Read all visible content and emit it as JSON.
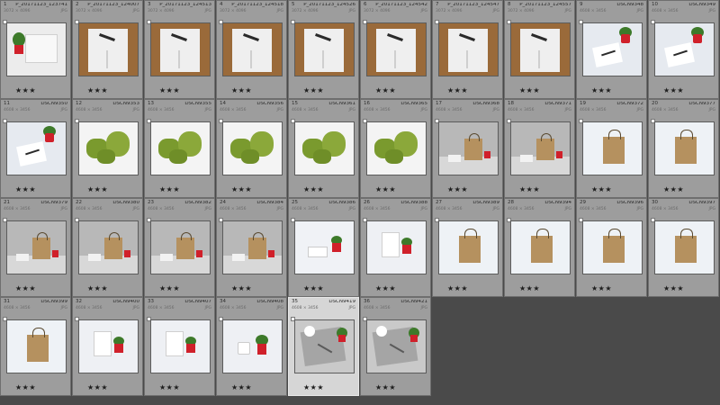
{
  "library": {
    "rating_glyph": "★",
    "thumbnails": [
      {
        "index": "1",
        "filename": "P_20171123_123741",
        "dims": "3072 × 4096",
        "ext": "JPG",
        "rating": 3,
        "scene": "notebook-plant",
        "selected": false
      },
      {
        "index": "2",
        "filename": "P_20171123_124007",
        "dims": "3072 × 4096",
        "ext": "JPG",
        "rating": 3,
        "scene": "notebook-board",
        "selected": false
      },
      {
        "index": "3",
        "filename": "P_20171123_124513",
        "dims": "3072 × 4096",
        "ext": "JPG",
        "rating": 3,
        "scene": "notebook-board",
        "selected": false
      },
      {
        "index": "4",
        "filename": "P_20171123_124518",
        "dims": "3072 × 4096",
        "ext": "JPG",
        "rating": 3,
        "scene": "notebook-board",
        "selected": false
      },
      {
        "index": "5",
        "filename": "P_20171123_124526",
        "dims": "3072 × 4096",
        "ext": "JPG",
        "rating": 3,
        "scene": "notebook-board",
        "selected": false
      },
      {
        "index": "6",
        "filename": "P_20171123_124542",
        "dims": "3072 × 4096",
        "ext": "JPG",
        "rating": 3,
        "scene": "notebook-board",
        "selected": false
      },
      {
        "index": "7",
        "filename": "P_20171123_124547",
        "dims": "3072 × 4096",
        "ext": "JPG",
        "rating": 3,
        "scene": "notebook-board",
        "selected": false
      },
      {
        "index": "8",
        "filename": "P_20171123_124557",
        "dims": "3072 × 4096",
        "ext": "JPG",
        "rating": 3,
        "scene": "notebook-board",
        "selected": false
      },
      {
        "index": "9",
        "filename": "DSCN9348",
        "dims": "4608 × 3456",
        "ext": "JPG",
        "rating": 3,
        "scene": "plant-flatlay",
        "selected": false
      },
      {
        "index": "10",
        "filename": "DSCN9349",
        "dims": "4608 × 3456",
        "ext": "JPG",
        "rating": 3,
        "scene": "plant-flatlay",
        "selected": false
      },
      {
        "index": "11",
        "filename": "DSCN9350",
        "dims": "4608 × 3456",
        "ext": "JPG",
        "rating": 3,
        "scene": "plant-flatlay",
        "selected": false
      },
      {
        "index": "12",
        "filename": "DSCN9353",
        "dims": "4608 × 3456",
        "ext": "JPG",
        "rating": 3,
        "scene": "moss",
        "selected": false
      },
      {
        "index": "13",
        "filename": "DSCN9355",
        "dims": "4608 × 3456",
        "ext": "JPG",
        "rating": 3,
        "scene": "moss",
        "selected": false
      },
      {
        "index": "14",
        "filename": "DSCN9356",
        "dims": "4608 × 3456",
        "ext": "JPG",
        "rating": 3,
        "scene": "moss",
        "selected": false
      },
      {
        "index": "15",
        "filename": "DSCN9361",
        "dims": "4608 × 3456",
        "ext": "JPG",
        "rating": 3,
        "scene": "moss",
        "selected": false
      },
      {
        "index": "16",
        "filename": "DSCN9365",
        "dims": "4608 × 3456",
        "ext": "JPG",
        "rating": 3,
        "scene": "moss",
        "selected": false
      },
      {
        "index": "17",
        "filename": "DSCN9368",
        "dims": "4608 × 3456",
        "ext": "JPG",
        "rating": 3,
        "scene": "bag-studio",
        "selected": false
      },
      {
        "index": "18",
        "filename": "DSCN9371",
        "dims": "4608 × 3456",
        "ext": "JPG",
        "rating": 3,
        "scene": "bag-studio",
        "selected": false
      },
      {
        "index": "19",
        "filename": "DSCN9372",
        "dims": "4608 × 3456",
        "ext": "JPG",
        "rating": 3,
        "scene": "bag-white",
        "selected": false
      },
      {
        "index": "20",
        "filename": "DSCN9377",
        "dims": "4608 × 3456",
        "ext": "JPG",
        "rating": 3,
        "scene": "bag-white",
        "selected": false
      },
      {
        "index": "21",
        "filename": "DSCN9379",
        "dims": "4608 × 3456",
        "ext": "JPG",
        "rating": 3,
        "scene": "bag-studio",
        "selected": false
      },
      {
        "index": "22",
        "filename": "DSCN9380",
        "dims": "4608 × 3456",
        "ext": "JPG",
        "rating": 3,
        "scene": "bag-studio",
        "selected": false
      },
      {
        "index": "23",
        "filename": "DSCN9382",
        "dims": "4608 × 3456",
        "ext": "JPG",
        "rating": 3,
        "scene": "bag-studio",
        "selected": false
      },
      {
        "index": "24",
        "filename": "DSCN9384",
        "dims": "4608 × 3456",
        "ext": "JPG",
        "rating": 3,
        "scene": "bag-studio",
        "selected": false
      },
      {
        "index": "25",
        "filename": "DSCN9386",
        "dims": "4608 × 3456",
        "ext": "JPG",
        "rating": 3,
        "scene": "box-plant",
        "selected": false
      },
      {
        "index": "26",
        "filename": "DSCN9388",
        "dims": "4608 × 3456",
        "ext": "JPG",
        "rating": 3,
        "scene": "card-plant",
        "selected": false
      },
      {
        "index": "27",
        "filename": "DSCN9389",
        "dims": "4608 × 3456",
        "ext": "JPG",
        "rating": 3,
        "scene": "bag-white",
        "selected": false
      },
      {
        "index": "28",
        "filename": "DSCN9394",
        "dims": "4608 × 3456",
        "ext": "JPG",
        "rating": 3,
        "scene": "bag-white",
        "selected": false
      },
      {
        "index": "29",
        "filename": "DSCN9396",
        "dims": "4608 × 3456",
        "ext": "JPG",
        "rating": 3,
        "scene": "bag-white",
        "selected": false
      },
      {
        "index": "30",
        "filename": "DSCN9397",
        "dims": "4608 × 3456",
        "ext": "JPG",
        "rating": 3,
        "scene": "bag-white",
        "selected": false
      },
      {
        "index": "31",
        "filename": "DSCN9399",
        "dims": "4608 × 3456",
        "ext": "JPG",
        "rating": 3,
        "scene": "bag-white",
        "selected": false
      },
      {
        "index": "32",
        "filename": "DSCN9400",
        "dims": "4608 × 3456",
        "ext": "JPG",
        "rating": 3,
        "scene": "card-plant",
        "selected": false
      },
      {
        "index": "33",
        "filename": "DSCN9407",
        "dims": "4608 × 3456",
        "ext": "JPG",
        "rating": 3,
        "scene": "card-plant",
        "selected": false
      },
      {
        "index": "34",
        "filename": "DSCN9408",
        "dims": "4608 × 3456",
        "ext": "JPG",
        "rating": 3,
        "scene": "mug-plant",
        "selected": false
      },
      {
        "index": "35",
        "filename": "DSCN9419",
        "dims": "4608 × 3456",
        "ext": "JPG",
        "rating": 3,
        "scene": "tray",
        "selected": true
      },
      {
        "index": "36",
        "filename": "DSCN9421",
        "dims": "4608 × 3456",
        "ext": "JPG",
        "rating": 3,
        "scene": "tray",
        "selected": false
      }
    ]
  },
  "colors": {
    "grid_background": "#4a4a4a",
    "cell_background": "#9d9d9d",
    "cell_selected": "#d6d6d6",
    "plant_red": "#d0202a",
    "moss_green": "#7a9a2e",
    "kraft_bag": "#b5915f",
    "cork_board": "#9a6a3a"
  }
}
